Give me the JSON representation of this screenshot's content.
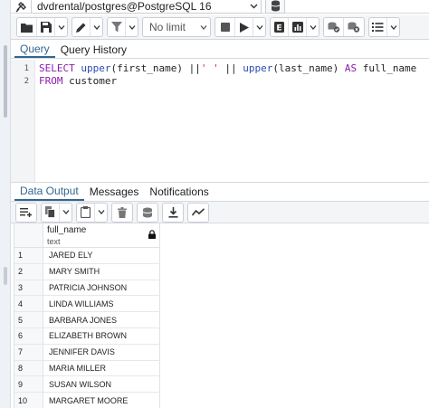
{
  "connection": {
    "label": "dvdrental/postgres@PostgreSQL 16"
  },
  "toolbar": {
    "limit_value": "No limit"
  },
  "query_tabs": [
    {
      "label": "Query",
      "active": true
    },
    {
      "label": "Query History",
      "active": false
    }
  ],
  "editor": {
    "lines": [
      {
        "number": "1"
      },
      {
        "number": "2"
      }
    ]
  },
  "result_tabs": [
    {
      "label": "Data Output",
      "active": true
    },
    {
      "label": "Messages",
      "active": false
    },
    {
      "label": "Notifications",
      "active": false
    }
  ],
  "grid": {
    "column": {
      "name": "full_name",
      "type": "text"
    },
    "rows": [
      {
        "n": "1",
        "value": "JARED ELY"
      },
      {
        "n": "2",
        "value": "MARY SMITH"
      },
      {
        "n": "3",
        "value": "PATRICIA JOHNSON"
      },
      {
        "n": "4",
        "value": "LINDA WILLIAMS"
      },
      {
        "n": "5",
        "value": "BARBARA JONES"
      },
      {
        "n": "6",
        "value": "ELIZABETH BROWN"
      },
      {
        "n": "7",
        "value": "JENNIFER DAVIS"
      },
      {
        "n": "8",
        "value": "MARIA MILLER"
      },
      {
        "n": "9",
        "value": "SUSAN WILSON"
      },
      {
        "n": "10",
        "value": "MARGARET MOORE"
      }
    ]
  },
  "colors": {
    "accent": "#326690",
    "keyword": "#8a1bab",
    "function": "#2b4ab3",
    "string": "#c0392b"
  }
}
